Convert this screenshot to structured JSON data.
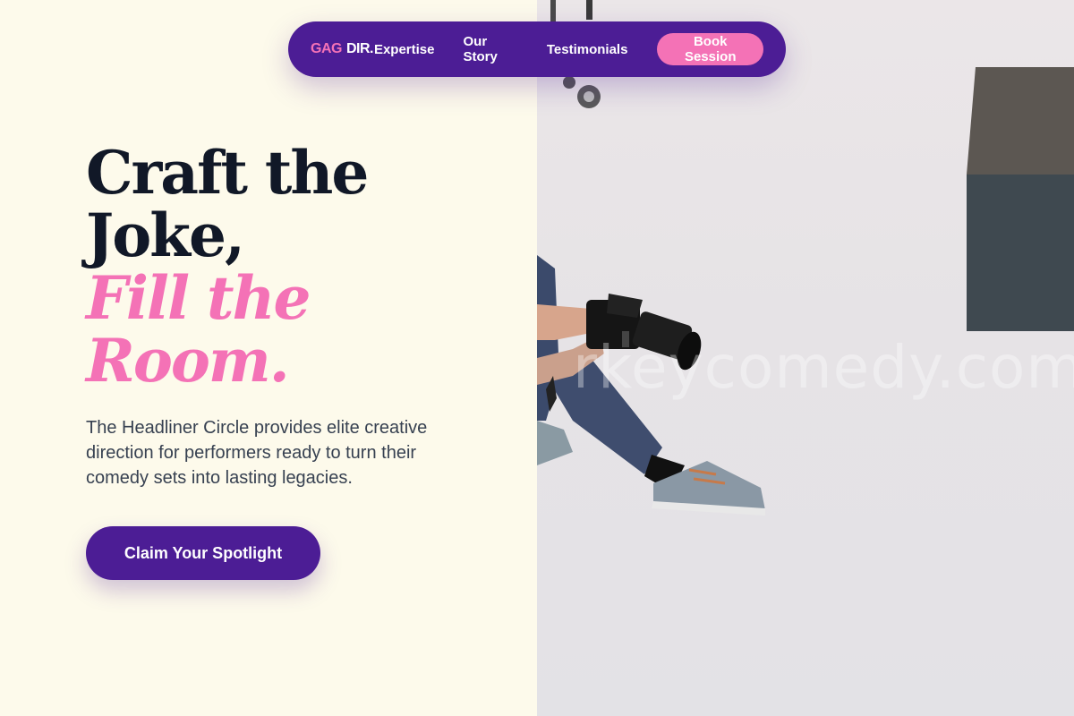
{
  "nav": {
    "logo": {
      "part1": "GAG",
      "part2": "DIR.",
      "part3": "Expertise"
    },
    "links": [
      {
        "label": "Our Story"
      },
      {
        "label": "Testimonials"
      }
    ],
    "cta_label": "Book Session"
  },
  "hero": {
    "title_line1": "Craft the",
    "title_line2": "Joke,",
    "title_accent1": "Fill the",
    "title_accent2": "Room.",
    "description": "The Headliner Circle provides elite creative direction for performers ready to turn their comedy sets into lasting legacies.",
    "cta_label": "Claim Your Spotlight"
  },
  "image": {
    "watermark": "rkeycomedy.com"
  },
  "colors": {
    "brand_purple": "#4c1d95",
    "accent_pink": "#f472b6",
    "background_cream": "#fdfaeb",
    "heading_dark": "#111827"
  }
}
